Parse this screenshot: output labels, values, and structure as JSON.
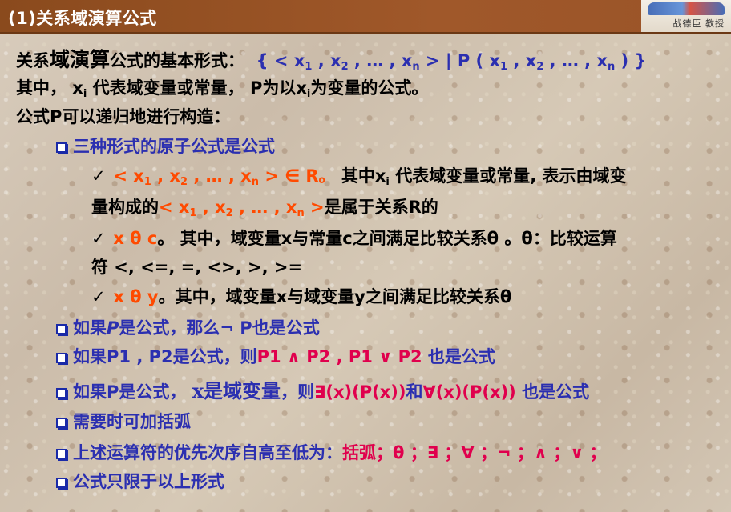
{
  "title": "(1)关系域演算公式",
  "logo": {
    "text": "战德臣 教授"
  },
  "lines": {
    "l1": {
      "a": "关系",
      "b": "域演算",
      "c": "公式的基本形式：",
      "f": "{ < x",
      "s1": "1",
      "g": " , x",
      "s2": "2",
      "h": " , … , x",
      "s3": "n",
      "i": " > | P ( x",
      "s4": "1",
      "j": " , x",
      "s5": "2",
      "k": " , … , x",
      "s6": "n",
      "m": " ) }"
    },
    "l2": {
      "a": "其中，  x",
      "s": "i",
      "b": " 代表域变量或常量，  P为以x",
      "s2": "i",
      "c": "为变量的公式。"
    },
    "l3": {
      "a": "公式P可以递归地进行构造："
    },
    "l4": {
      "a": "三种形式的原子公式是公式"
    },
    "l5": {
      "check": "✓",
      "r1": "< x",
      "s1": "1",
      "r2": " , x",
      "s2": "2",
      "r3": " , … , x",
      "s3": "n",
      "r4": " >  ∈ R。",
      "a": " 其中x",
      "s4": "i",
      "b": " 代表域变量或常量, 表示由域变"
    },
    "l6": {
      "a": "量构成的",
      "r1": "< x",
      "s1": "1",
      "r2": " , x",
      "s2": "2",
      "r3": " , … , x",
      "s3": "n",
      "r4": " >",
      "b": "是属于关系R的"
    },
    "l7": {
      "check": "✓",
      "r": "x θ c",
      "a": "。 其中，域变量x与常量c之间满足比较关系θ 。θ：比较运算"
    },
    "l8": {
      "a": "符 <,  <=,  =,  <>,  >,  >="
    },
    "l9": {
      "check": "✓",
      "r": "x θ y",
      "a": "。其中，域变量x与域变量y之间满足比较关系θ"
    },
    "l10": {
      "a": "如果",
      "p": "P",
      "b": "是公式，那么¬ P也是公式"
    },
    "l11": {
      "a": "如果P1 , P2是公式，则",
      "m": "P1 ∧ P2 , P1 ∨ P2",
      "b": " 也是公式"
    },
    "l12": {
      "a": "如果P是公式，  ",
      "x": "x是域变量",
      "b": "，则",
      "m1": "∃(x)(P(x))",
      "c": "和",
      "m2": "∀(x)(P(x))",
      "d": " 也是公式"
    },
    "l13": {
      "a": "需要时可加括弧"
    },
    "l14": {
      "a": "上述运算符的优先次序自高至低为：",
      "m": "括弧；θ ；∃ ；∀ ；¬ ；∧ ；∨ ；"
    },
    "l15": {
      "a": "公式只限于以上形式"
    }
  },
  "colors": {
    "blue": "#2b2fb0",
    "red": "#ff4a00",
    "magenta": "#e0004d",
    "titlebar": "#9a5428"
  }
}
